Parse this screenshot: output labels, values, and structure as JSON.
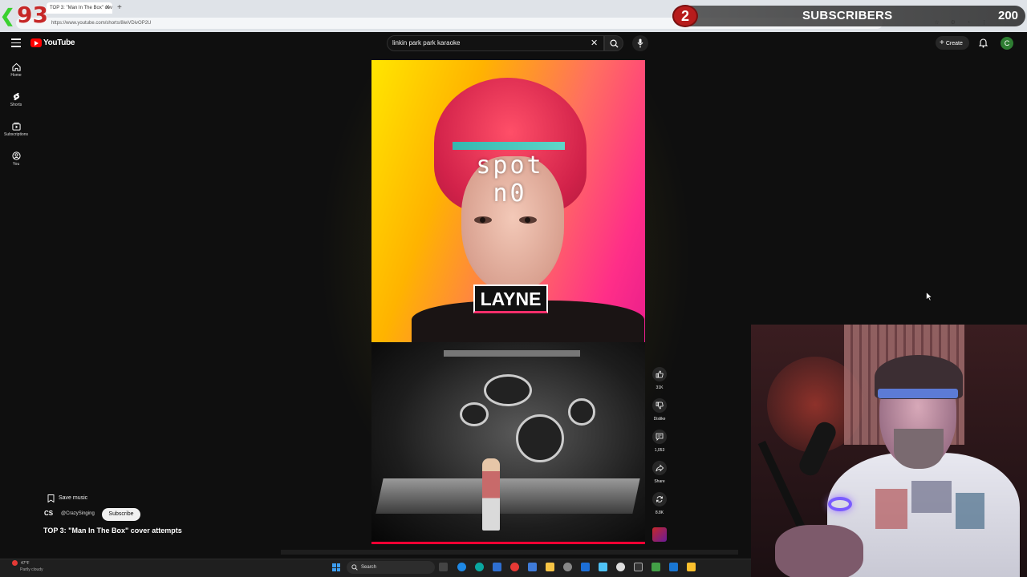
{
  "browser": {
    "tab_title": "TOP 3: \"Man In The Box\" cov",
    "new_tab": "+",
    "address": "https://www.youtube.com/shorts/8iwVDivOP2U"
  },
  "overlay": {
    "death_counter": "93",
    "subscriber_count": "2",
    "subscriber_label": "SUBSCRIBERS",
    "subscriber_goal": "200"
  },
  "youtube": {
    "brand": "YouTube",
    "search_query": "linkin park park karaoke",
    "create_label": "Create",
    "avatar_letter": "C",
    "sidebar": [
      {
        "label": "Home",
        "icon": "home-icon"
      },
      {
        "label": "Shorts",
        "icon": "shorts-icon"
      },
      {
        "label": "Subscriptions",
        "icon": "subscriptions-icon"
      },
      {
        "label": "You",
        "icon": "you-icon"
      }
    ]
  },
  "video": {
    "overlay_word": "spot n0",
    "name_card": "LAYNE",
    "progress": 1.0
  },
  "actions": {
    "likes": "31K",
    "dislike": "Dislike",
    "comments": "1,053",
    "share": "Share",
    "remix": "8.8K"
  },
  "meta": {
    "save_music": "Save music",
    "channel_icon": "CS",
    "channel": "@CrazySinging",
    "subscribe": "Subscribe",
    "title": "TOP 3: \"Man In The Box\" cover attempts"
  },
  "taskbar": {
    "temperature": "47°F",
    "weather": "Partly cloudy",
    "search_label": "Search"
  },
  "colors": {
    "youtube_red": "#ff0000",
    "progress": "#ff0033",
    "counter_red": "#c62828",
    "accent_green": "#2e7d32"
  }
}
